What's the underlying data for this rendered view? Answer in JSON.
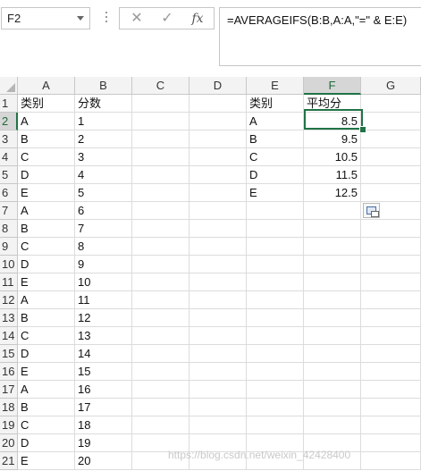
{
  "formula_bar": {
    "name_box": "F2",
    "cancel_icon": "✕",
    "enter_icon": "✓",
    "fx_label": "fx",
    "formula": "=AVERAGEIFS(B:B,A:A,\"=\" & E:E)"
  },
  "columns": [
    "A",
    "B",
    "C",
    "D",
    "E",
    "F",
    "G"
  ],
  "selected_column": "F",
  "selected_row": 2,
  "rows": [
    {
      "n": "1",
      "A": "类别",
      "B": "分数",
      "E": "类别",
      "F": "平均分"
    },
    {
      "n": "2",
      "A": "A",
      "B": "1",
      "E": "A",
      "F": "8.5"
    },
    {
      "n": "3",
      "A": "B",
      "B": "2",
      "E": "B",
      "F": "9.5"
    },
    {
      "n": "4",
      "A": "C",
      "B": "3",
      "E": "C",
      "F": "10.5"
    },
    {
      "n": "5",
      "A": "D",
      "B": "4",
      "E": "D",
      "F": "11.5"
    },
    {
      "n": "6",
      "A": "E",
      "B": "5",
      "E": "E",
      "F": "12.5"
    },
    {
      "n": "7",
      "A": "A",
      "B": "6"
    },
    {
      "n": "8",
      "A": "B",
      "B": "7"
    },
    {
      "n": "9",
      "A": "C",
      "B": "8"
    },
    {
      "n": "10",
      "A": "D",
      "B": "9"
    },
    {
      "n": "11",
      "A": "E",
      "B": "10"
    },
    {
      "n": "12",
      "A": "A",
      "B": "11"
    },
    {
      "n": "13",
      "A": "B",
      "B": "12"
    },
    {
      "n": "14",
      "A": "C",
      "B": "13"
    },
    {
      "n": "15",
      "A": "D",
      "B": "14"
    },
    {
      "n": "16",
      "A": "E",
      "B": "15"
    },
    {
      "n": "17",
      "A": "A",
      "B": "16"
    },
    {
      "n": "18",
      "A": "B",
      "B": "17"
    },
    {
      "n": "19",
      "A": "C",
      "B": "18"
    },
    {
      "n": "20",
      "A": "D",
      "B": "19"
    },
    {
      "n": "21",
      "A": "E",
      "B": "20"
    }
  ],
  "watermark": "https://blog.csdn.net/weixin_42428400",
  "colors": {
    "accent": "#217346",
    "header_bg": "#f3f3f3",
    "gridline": "#dcdcdc"
  }
}
